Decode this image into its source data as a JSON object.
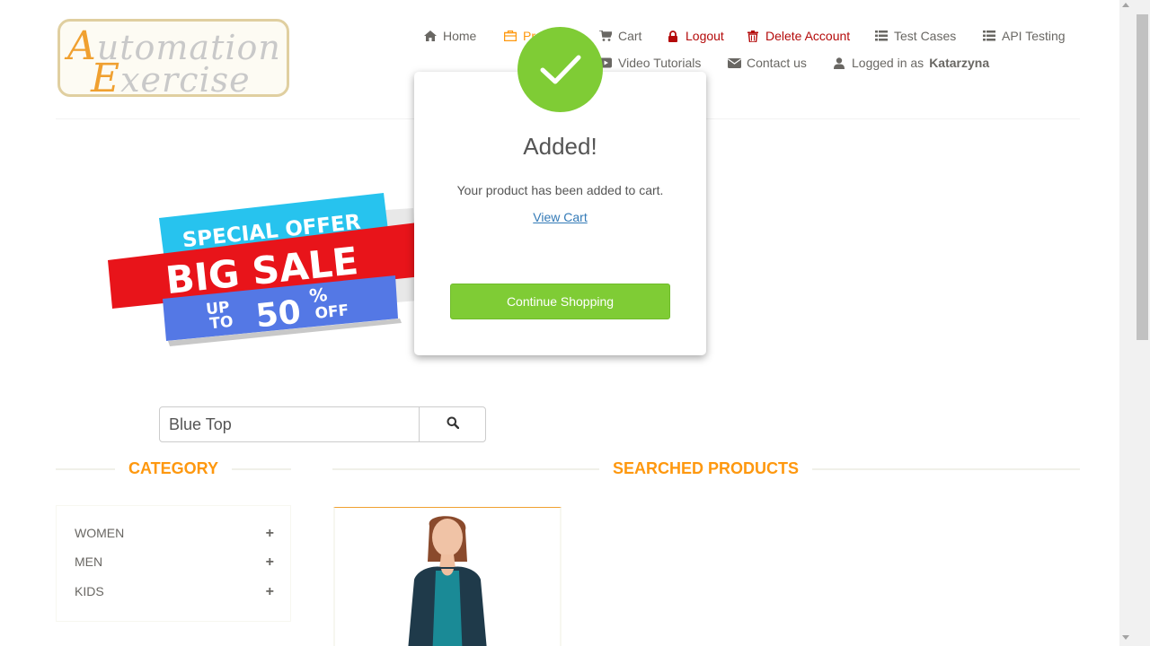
{
  "logo": {
    "line1_cap": "A",
    "line1_rest": "utomation",
    "line2_cap": "E",
    "line2_rest": "xercise"
  },
  "nav": {
    "home": "Home",
    "products": "Products",
    "cart": "Cart",
    "logout": "Logout",
    "delete_account": "Delete Account",
    "test_cases": "Test Cases",
    "api_testing": "API Testing",
    "video_tutorials": "Video Tutorials",
    "contact_us": "Contact us",
    "logged_in_prefix": "Logged in as",
    "username": "Katarzyna"
  },
  "banner": {
    "special_offer": "SPECIAL OFFER",
    "big_sale": "BIG SALE",
    "up": "UP",
    "to": "TO",
    "fifty": "50",
    "percent": "%",
    "off": "OFF"
  },
  "search": {
    "value": "Blue Top"
  },
  "sections": {
    "category_title": "CATEGORY",
    "products_title": "SEARCHED PRODUCTS"
  },
  "categories": [
    {
      "label": "WOMEN"
    },
    {
      "label": "MEN"
    },
    {
      "label": "KIDS"
    }
  ],
  "modal": {
    "title": "Added!",
    "message": "Your product has been added to cart.",
    "link": "View Cart",
    "button": "Continue Shopping"
  },
  "colors": {
    "accent_orange": "#fe980f",
    "success_green": "#7fcc35",
    "logout_red": "#b40a0a",
    "link_blue": "#337ab7"
  }
}
